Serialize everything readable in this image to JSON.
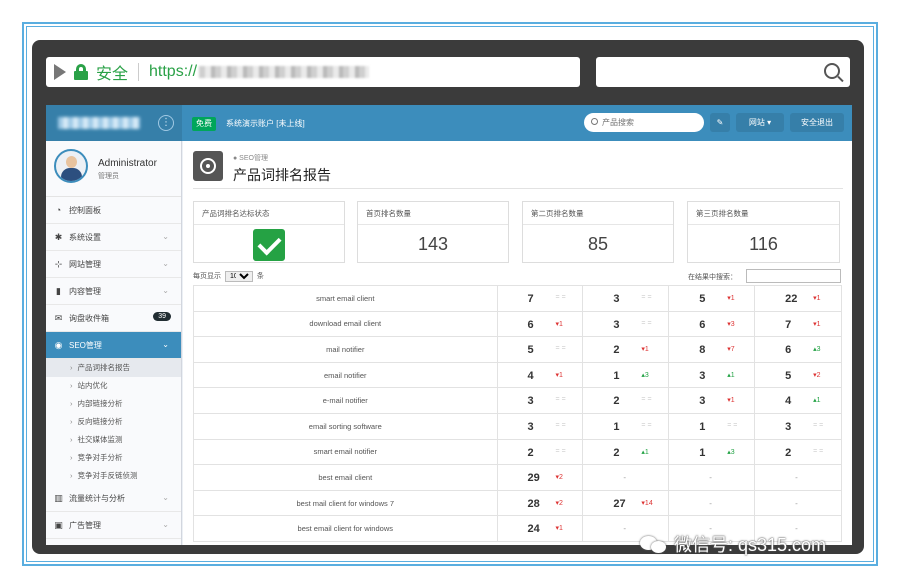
{
  "browser": {
    "security_label": "安全",
    "url_prefix": "https://"
  },
  "topnav": {
    "free_badge": "免费",
    "account_text": "系统演示账户 [未上线]",
    "search_placeholder": "产品搜索",
    "website_label": "网站 ▾",
    "logout_label": "安全退出"
  },
  "sidebar": {
    "user_name": "Administrator",
    "user_role": "管理员",
    "menu": [
      {
        "label": "控制面板",
        "icon": "dashboard-icon"
      },
      {
        "label": "系统设置",
        "icon": "gear-icon"
      },
      {
        "label": "网站管理",
        "icon": "sitemap-icon"
      },
      {
        "label": "内容管理",
        "icon": "book-icon"
      },
      {
        "label": "询盘收件箱",
        "icon": "envelope-icon",
        "badge": "39"
      },
      {
        "label": "SEO管理",
        "icon": "target-icon"
      }
    ],
    "seo_submenu": [
      "产品词排名报告",
      "站内优化",
      "内部链接分析",
      "反向链接分析",
      "社交媒体监测",
      "竞争对手分析",
      "竞争对手反链侦测"
    ],
    "menu_after": [
      {
        "label": "流量统计与分析",
        "icon": "bar-chart-icon"
      },
      {
        "label": "广告管理",
        "icon": "ad-icon"
      }
    ]
  },
  "page": {
    "breadcrumb": "● SEO管理",
    "title": "产品词排名报告"
  },
  "stats": {
    "status_label": "产品词排名达标状态",
    "page1_label": "首页排名数量",
    "page1_value": "143",
    "page2_label": "第二页排名数量",
    "page2_value": "85",
    "page3_label": "第三页排名数量",
    "page3_value": "116"
  },
  "table_controls": {
    "per_page_prefix": "每页显示",
    "per_page_value": "100 ▾",
    "per_page_suffix": "条",
    "search_label": "在结果中搜索："
  },
  "rows": [
    {
      "keyword": "smart email client",
      "ranks": [
        {
          "n": "7",
          "c": "= =",
          "d": "same"
        },
        {
          "n": "3",
          "c": "= =",
          "d": "same"
        },
        {
          "n": "5",
          "c": "▾1",
          "d": "down"
        },
        {
          "n": "22",
          "c": "▾1",
          "d": "down"
        }
      ]
    },
    {
      "keyword": "download email client",
      "ranks": [
        {
          "n": "6",
          "c": "▾1",
          "d": "down"
        },
        {
          "n": "3",
          "c": "= =",
          "d": "same"
        },
        {
          "n": "6",
          "c": "▾3",
          "d": "down"
        },
        {
          "n": "7",
          "c": "▾1",
          "d": "down"
        }
      ]
    },
    {
      "keyword": "mail notifier",
      "ranks": [
        {
          "n": "5",
          "c": "= =",
          "d": "same"
        },
        {
          "n": "2",
          "c": "▾1",
          "d": "down"
        },
        {
          "n": "8",
          "c": "▾7",
          "d": "down"
        },
        {
          "n": "6",
          "c": "▴3",
          "d": "up"
        }
      ]
    },
    {
      "keyword": "email notifier",
      "ranks": [
        {
          "n": "4",
          "c": "▾1",
          "d": "down"
        },
        {
          "n": "1",
          "c": "▴3",
          "d": "up"
        },
        {
          "n": "3",
          "c": "▴1",
          "d": "up"
        },
        {
          "n": "5",
          "c": "▾2",
          "d": "down"
        }
      ]
    },
    {
      "keyword": "e-mail notifier",
      "ranks": [
        {
          "n": "3",
          "c": "= =",
          "d": "same"
        },
        {
          "n": "2",
          "c": "= =",
          "d": "same"
        },
        {
          "n": "3",
          "c": "▾1",
          "d": "down"
        },
        {
          "n": "4",
          "c": "▴1",
          "d": "up"
        }
      ]
    },
    {
      "keyword": "email sorting software",
      "ranks": [
        {
          "n": "3",
          "c": "= =",
          "d": "same"
        },
        {
          "n": "1",
          "c": "= =",
          "d": "same"
        },
        {
          "n": "1",
          "c": "= =",
          "d": "same"
        },
        {
          "n": "3",
          "c": "= =",
          "d": "same"
        }
      ]
    },
    {
      "keyword": "smart email notifier",
      "ranks": [
        {
          "n": "2",
          "c": "= =",
          "d": "same"
        },
        {
          "n": "2",
          "c": "▴1",
          "d": "up"
        },
        {
          "n": "1",
          "c": "▴3",
          "d": "up"
        },
        {
          "n": "2",
          "c": "= =",
          "d": "same"
        }
      ]
    },
    {
      "keyword": "best email client",
      "ranks": [
        {
          "n": "29",
          "c": "▾2",
          "d": "down"
        },
        {
          "n": "-",
          "c": "",
          "d": "none"
        },
        {
          "n": "-",
          "c": "",
          "d": "none"
        },
        {
          "n": "-",
          "c": "",
          "d": "none"
        }
      ]
    },
    {
      "keyword": "best mail client for windows 7",
      "ranks": [
        {
          "n": "28",
          "c": "▾2",
          "d": "down"
        },
        {
          "n": "27",
          "c": "▾14",
          "d": "down"
        },
        {
          "n": "-",
          "c": "",
          "d": "none"
        },
        {
          "n": "-",
          "c": "",
          "d": "none"
        }
      ]
    },
    {
      "keyword": "best email client for windows",
      "ranks": [
        {
          "n": "24",
          "c": "▾1",
          "d": "down"
        },
        {
          "n": "-",
          "c": "",
          "d": "none"
        },
        {
          "n": "-",
          "c": "",
          "d": "none"
        },
        {
          "n": "-",
          "c": "",
          "d": "none"
        }
      ]
    }
  ],
  "watermark": {
    "text": "微信号: qs315.com"
  }
}
